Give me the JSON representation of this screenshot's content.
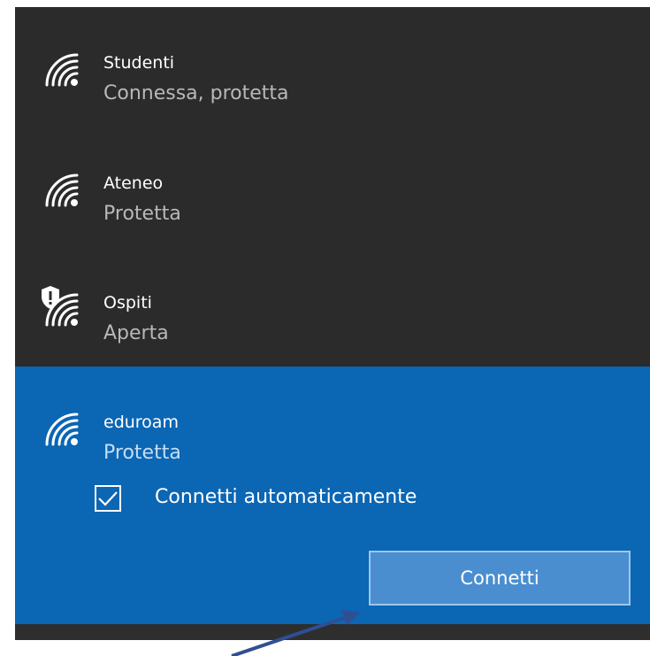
{
  "networks": [
    {
      "ssid": "Studenti",
      "status": "Connessa, protetta",
      "icon": "wifi-icon"
    },
    {
      "ssid": "Ateneo",
      "status": "Protetta",
      "icon": "wifi-icon"
    },
    {
      "ssid": "Ospiti",
      "status": "Aperta",
      "icon": "wifi-warning-icon"
    },
    {
      "ssid": "eduroam",
      "status": "Protetta",
      "icon": "wifi-icon"
    }
  ],
  "selected": {
    "auto_connect_label": "Connetti automaticamente",
    "auto_connect_checked": true,
    "connect_label": "Connetti"
  },
  "colors": {
    "panel": "#2b2b2b",
    "accent": "#0b66b4",
    "button": "#4a8ed0",
    "arrow": "#2f4f93"
  }
}
